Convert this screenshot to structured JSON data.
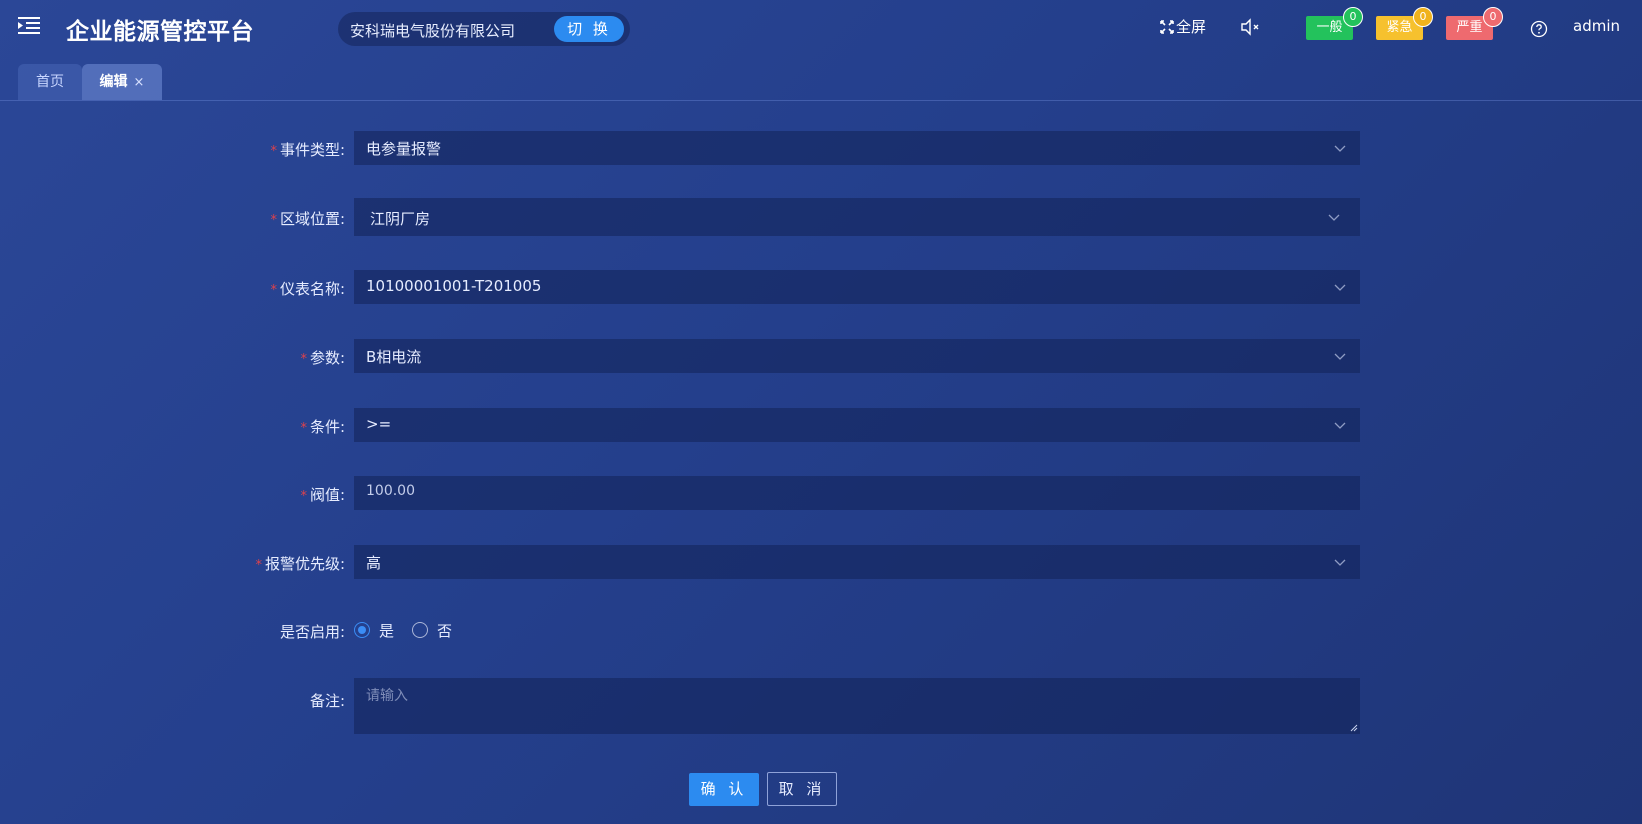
{
  "header": {
    "title": "企业能源管控平台",
    "company": "安科瑞电气股份有限公司",
    "switch_label": "切 换",
    "fullscreen_label": "全屏",
    "alarms": [
      {
        "label": "一般",
        "count": "0",
        "color": "#23c25c",
        "badge_color": "#23c25c"
      },
      {
        "label": "紧急",
        "count": "0",
        "color": "#f6c12e",
        "badge_color": "#f0b21c"
      },
      {
        "label": "严重",
        "count": "0",
        "color": "#ee6a6f",
        "badge_color": "#ee6a6f"
      }
    ],
    "user": "admin"
  },
  "tabs": [
    {
      "label": "首页"
    },
    {
      "label": "编辑",
      "close": "×"
    }
  ],
  "form": {
    "event_type": {
      "label": "事件类型:",
      "value": "电参量报警"
    },
    "region": {
      "label": "区域位置:",
      "value": "江阴厂房"
    },
    "meter": {
      "label": "仪表名称:",
      "value": "10100001001-T201005"
    },
    "param": {
      "label": "参数:",
      "value": "B相电流"
    },
    "condition": {
      "label": "条件:",
      "value": ">="
    },
    "threshold": {
      "label": "阀值:",
      "value": "100.00"
    },
    "priority": {
      "label": "报警优先级:",
      "value": "高"
    },
    "enabled": {
      "label": "是否启用:",
      "options": [
        "是",
        "否"
      ],
      "selected": "是"
    },
    "remark": {
      "label": "备注:",
      "placeholder": "请输入"
    },
    "required_mark": "*"
  },
  "actions": {
    "confirm": "确 认",
    "cancel": "取 消"
  },
  "colors": {
    "accent": "#2c8bf0",
    "required": "#e0424b"
  }
}
